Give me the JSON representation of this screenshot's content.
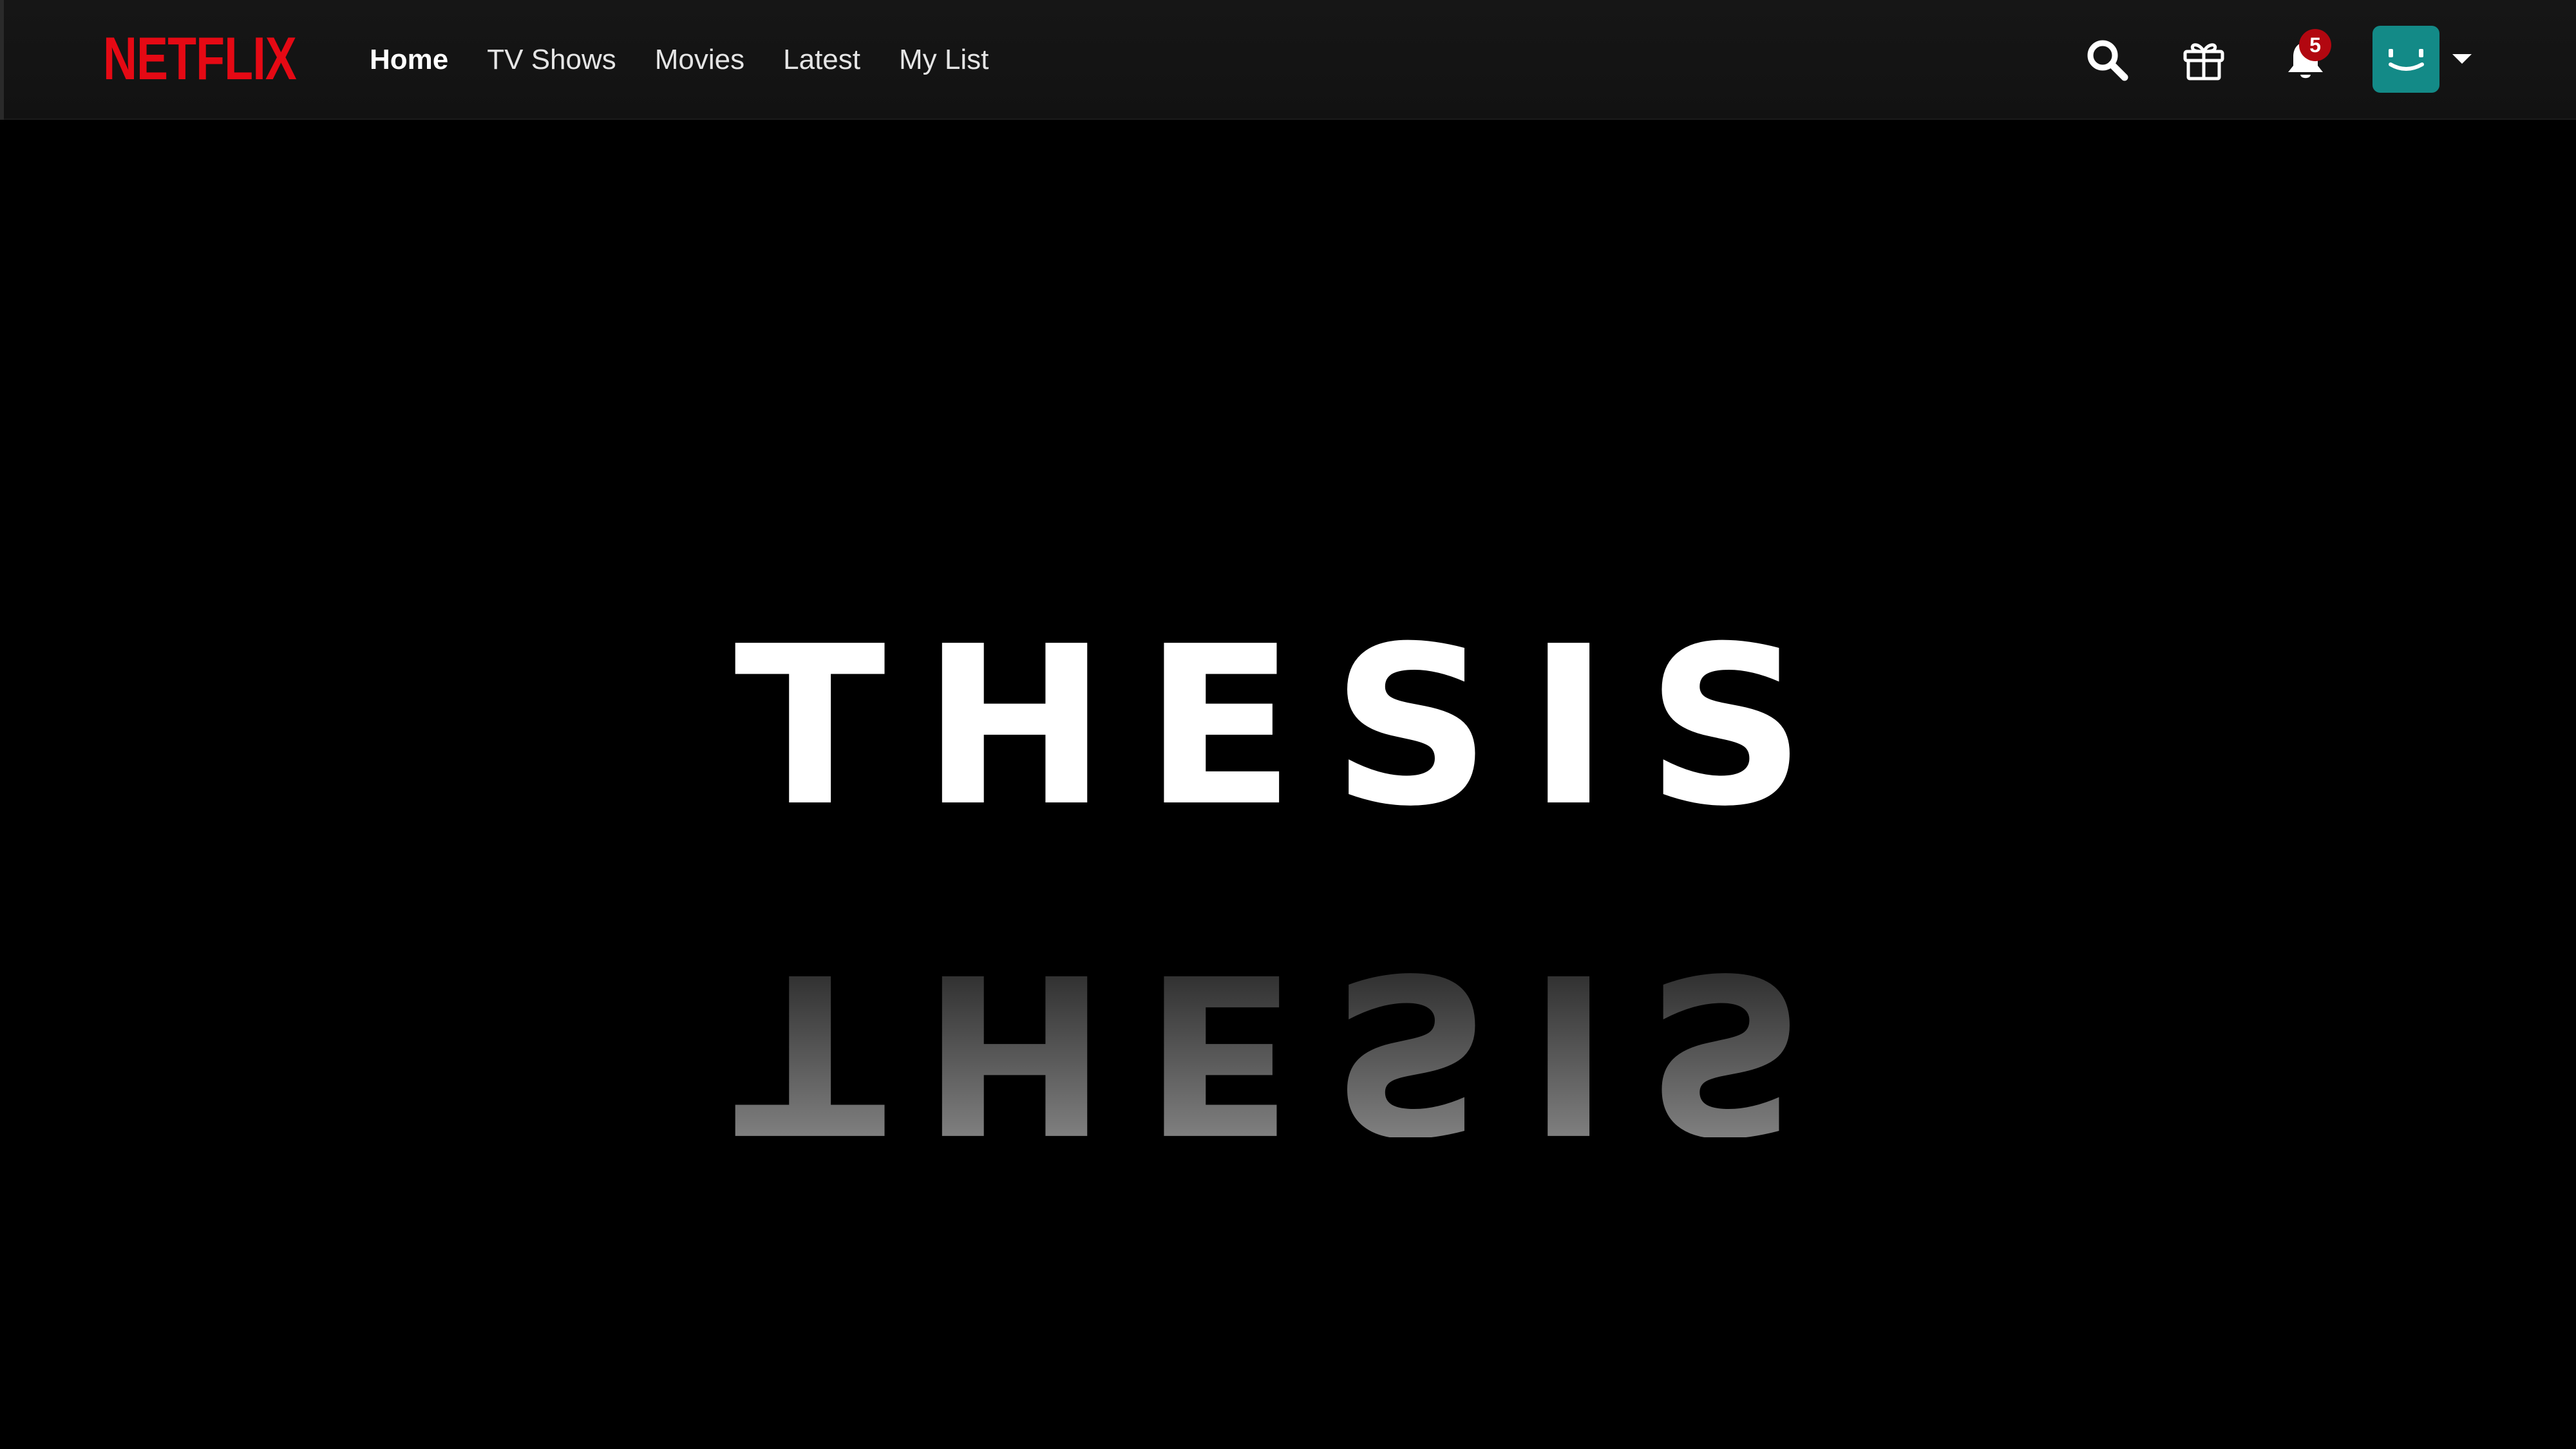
{
  "app": {
    "brand": "NETFLIX",
    "brand_color": "#e50914"
  },
  "nav": {
    "links": [
      {
        "label": "Home",
        "active": true
      },
      {
        "label": "TV Shows",
        "active": false
      },
      {
        "label": "Movies",
        "active": false
      },
      {
        "label": "Latest",
        "active": false
      },
      {
        "label": "My List",
        "active": false
      }
    ]
  },
  "toolbar": {
    "search_icon": "search-icon",
    "gift_icon": "gift-icon",
    "notifications_icon": "bell-icon",
    "notification_count": "5",
    "badge_color": "#b20710",
    "profile_color": "#138a87",
    "menu_icon": "caret-down-icon"
  },
  "hero": {
    "title": "THESIS",
    "title_color": "#ffffff"
  }
}
